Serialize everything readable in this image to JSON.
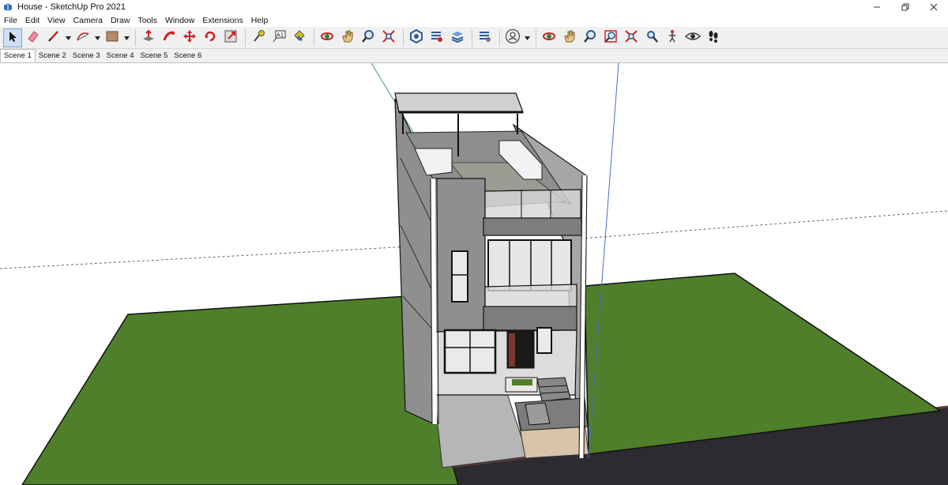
{
  "window": {
    "title": "House - SketchUp Pro 2021"
  },
  "menu": [
    "File",
    "Edit",
    "View",
    "Camera",
    "Draw",
    "Tools",
    "Window",
    "Extensions",
    "Help"
  ],
  "scenes": [
    "Scene 1",
    "Scene 2",
    "Scene 3",
    "Scene 4",
    "Scene 5",
    "Scene 6"
  ],
  "active_scene": "Scene 1",
  "toolbar_icons": [
    "select-icon",
    "eraser-icon",
    "line-icon",
    "arc-icon",
    "rectangle-icon",
    "push-pull-icon",
    "follow-me-icon",
    "move-icon",
    "rotate-icon",
    "scale-icon",
    "tape-measure-icon",
    "text-icon",
    "paint-bucket-icon",
    "orbit-icon",
    "pan-icon",
    "zoom-icon",
    "zoom-extents-icon",
    "warehouse-icon",
    "extension-warehouse-icon",
    "send-to-layout-icon",
    "extension-manager-icon",
    "account-icon",
    "orbit-icon",
    "pan-icon",
    "zoom-icon",
    "zoom-window-icon",
    "zoom-extents-icon",
    "position-camera-icon",
    "walk-icon",
    "look-around-icon",
    "footprints-icon"
  ],
  "colors": {
    "grass": "#4f7f2a",
    "road": "#2e2b30",
    "wall": "#8f8f8f",
    "wall_light": "#a6a6a6",
    "selection": "#cfe0f5"
  }
}
